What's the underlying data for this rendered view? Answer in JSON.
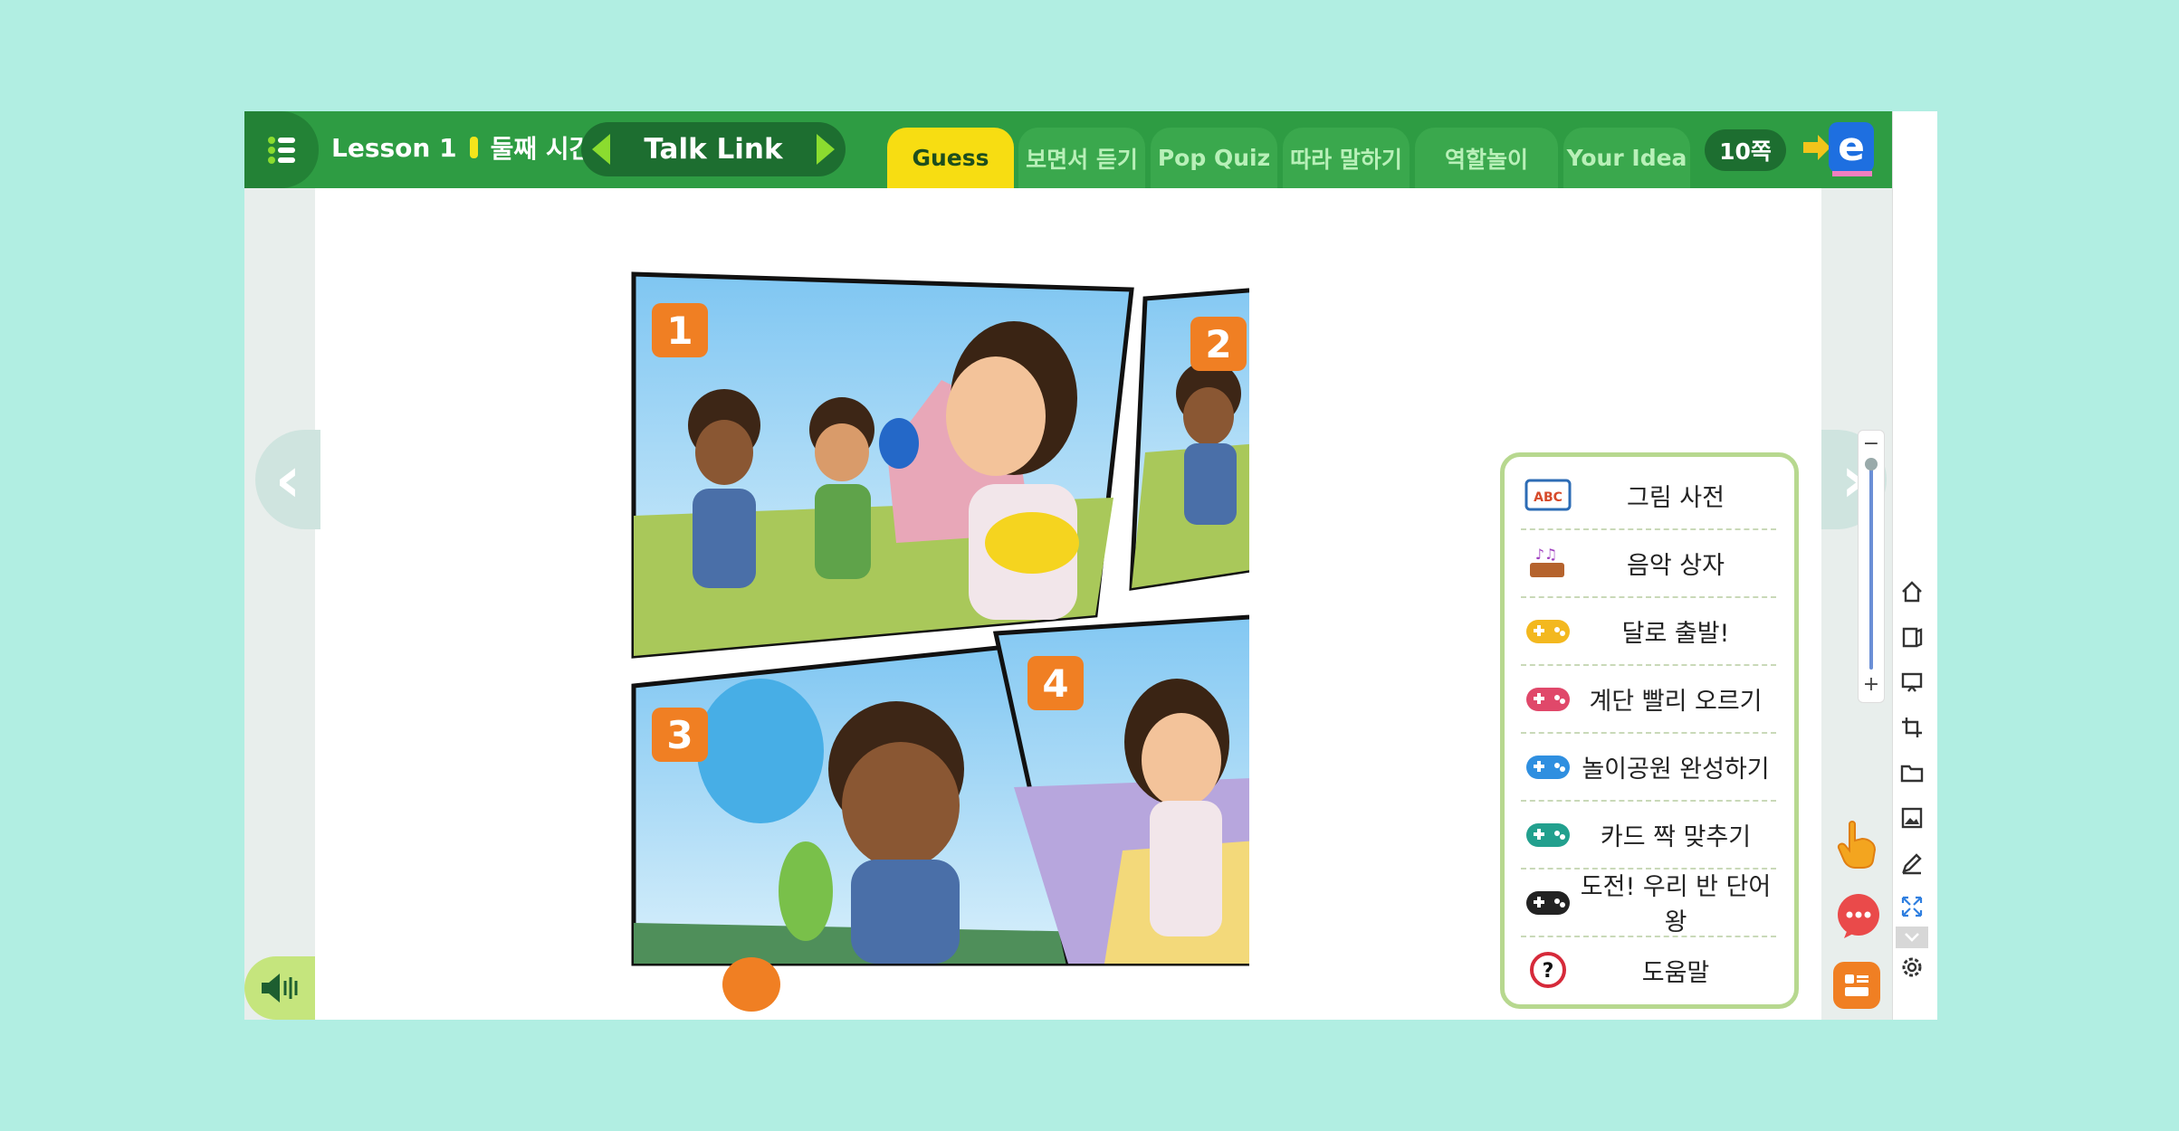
{
  "header": {
    "lesson": "Lesson 1",
    "session": "둘째 시간",
    "title": "Talk Link",
    "page": "10쪽"
  },
  "tabs": [
    {
      "label": "Guess",
      "active": true
    },
    {
      "label": "보면서 듣기"
    },
    {
      "label": "Pop Quiz"
    },
    {
      "label": "따라 말하기"
    },
    {
      "label": "역할놀이"
    },
    {
      "label": "Your Idea"
    }
  ],
  "panels": [
    "1",
    "2",
    "3",
    "4"
  ],
  "popup_menu": [
    {
      "label": "그림 사전",
      "icon": "picture-dictionary-icon"
    },
    {
      "label": "음악 상자",
      "icon": "music-box-icon"
    },
    {
      "label": "달로 출발!",
      "icon": "gamepad-yellow-icon"
    },
    {
      "label": "계단 빨리 오르기",
      "icon": "gamepad-pink-icon"
    },
    {
      "label": "놀이공원 완성하기",
      "icon": "gamepad-blue-icon"
    },
    {
      "label": "카드 짝 맞추기",
      "icon": "gamepad-teal-icon"
    },
    {
      "label": "도전! 우리 반 단어왕",
      "icon": "gamepad-black-icon"
    },
    {
      "label": "도움말",
      "icon": "help-icon"
    }
  ],
  "zoom": {
    "minus": "−",
    "plus": "+"
  },
  "colors": {
    "accent": "#2e9c43",
    "active_tab": "#f7dd12",
    "orange": "#f07f23"
  }
}
